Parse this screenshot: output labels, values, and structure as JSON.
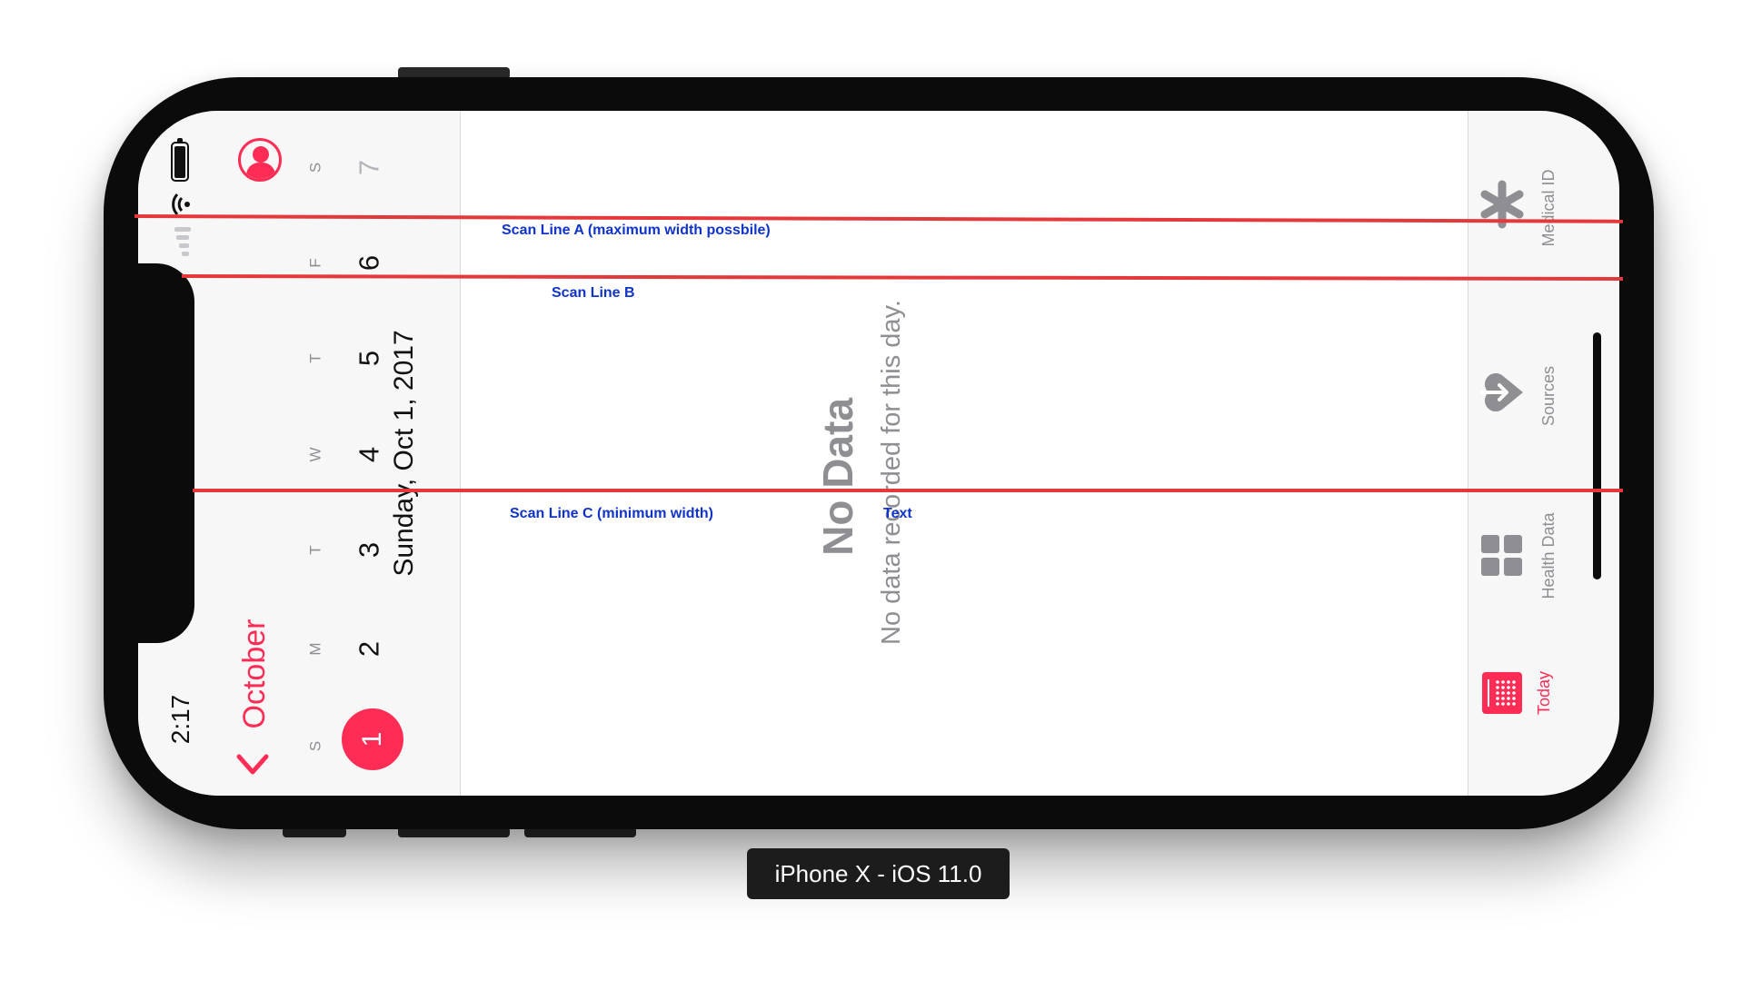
{
  "status_bar": {
    "time": "2:17"
  },
  "calendar": {
    "month_label": "October",
    "selected_date": "Sunday, Oct 1, 2017",
    "days": [
      {
        "dow": "S",
        "num": "1"
      },
      {
        "dow": "M",
        "num": "2"
      },
      {
        "dow": "T",
        "num": "3"
      },
      {
        "dow": "W",
        "num": "4"
      },
      {
        "dow": "T",
        "num": "5"
      },
      {
        "dow": "F",
        "num": "6"
      },
      {
        "dow": "S",
        "num": "7"
      }
    ]
  },
  "content": {
    "title": "No Data",
    "message": "No data recorded for this day."
  },
  "tabs": [
    {
      "label": "Today",
      "icon": "calendar-icon",
      "active": true
    },
    {
      "label": "Health Data",
      "icon": "grid-icon",
      "active": false
    },
    {
      "label": "Sources",
      "icon": "heart-arrow-icon",
      "active": false
    },
    {
      "label": "Medical ID",
      "icon": "asterisk-icon",
      "active": false
    }
  ],
  "annotations": {
    "scan_a": "Scan Line A (maximum width possbile)",
    "scan_b": "Scan Line B",
    "scan_c": "Scan Line C  (minimum width)",
    "text": "Text"
  },
  "device_label": "iPhone X - iOS 11.0",
  "colors": {
    "accent": "#ff2d55",
    "scan_line": "#e5383b",
    "annotation": "#1034c9",
    "secondary_text": "#8e8e93"
  }
}
